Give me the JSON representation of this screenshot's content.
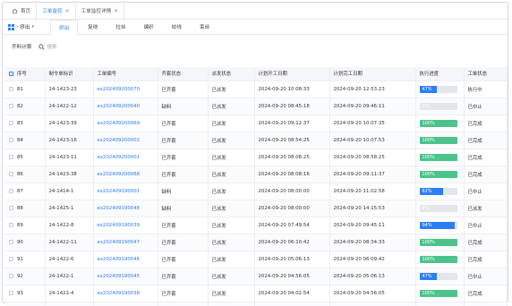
{
  "colors": {
    "accent": "#2d7ef7",
    "progress_green": "#4cc38a",
    "progress_blue": "#2d7ef7"
  },
  "tabstrip": {
    "tabs": [
      {
        "label": "首页",
        "icon": "home-icon",
        "closable": false
      },
      {
        "label": "工单监控",
        "closable": true,
        "active": true
      },
      {
        "label": "工单监控详情",
        "closable": true
      }
    ]
  },
  "subbar": {
    "crumb": "挤出",
    "tabs": [
      "挤出",
      "复绕",
      "拉丝",
      "编织",
      "绞线",
      "束丝"
    ],
    "active_tab": 0
  },
  "actions": {
    "button": "齐料计算",
    "search_placeholder": "搜索"
  },
  "table": {
    "headers": [
      "序号",
      "制令单标识",
      "工单编号",
      "齐套状态",
      "派发状态",
      "计划开工日期",
      "计划完工日期",
      "执行进度",
      "工单状态"
    ],
    "rows": [
      {
        "seq": "81",
        "order_id": "24-1423-23",
        "wo": "ex202409200070",
        "kit": "已齐套",
        "dispatch": "已派发",
        "start": "2024-09-20 10:08:33",
        "end": "2024-09-20 12:53:23",
        "progress": 47,
        "color": "blue",
        "status": "执行中"
      },
      {
        "seq": "82",
        "order_id": "24-1422-12",
        "wo": "ex202409200040",
        "kit": "缺料",
        "dispatch": "已派发",
        "start": "2024-09-20 08:45:18",
        "end": "2024-09-20 09:46:11",
        "progress": 0,
        "color": "blue",
        "status": "已中止"
      },
      {
        "seq": "83",
        "order_id": "24-1423-39",
        "wo": "ex202409200069",
        "kit": "已齐套",
        "dispatch": "已派发",
        "start": "2024-09-20 09:12:37",
        "end": "2024-09-20 10:07:35",
        "progress": 100,
        "color": "green",
        "status": "已完成"
      },
      {
        "seq": "84",
        "order_id": "24-1423-16",
        "wo": "ex202409200002",
        "kit": "已齐套",
        "dispatch": "已派发",
        "start": "2024-09-20 08:54:25",
        "end": "2024-09-20 10:07:53",
        "progress": 100,
        "color": "green",
        "status": "已完成"
      },
      {
        "seq": "85",
        "order_id": "24-1423-11",
        "wo": "ex202409200001",
        "kit": "已齐套",
        "dispatch": "已派发",
        "start": "2024-09-20 08:08:25",
        "end": "2024-09-20 08:58:25",
        "progress": 100,
        "color": "green",
        "status": "已完成"
      },
      {
        "seq": "86",
        "order_id": "24-1423-38",
        "wo": "ex202409200068",
        "kit": "已齐套",
        "dispatch": "已派发",
        "start": "2024-09-20 08:08:16",
        "end": "2024-09-20 09:11:37",
        "progress": 100,
        "color": "green",
        "status": "已完成"
      },
      {
        "seq": "87",
        "order_id": "24-1414-1",
        "wo": "ex202409190001",
        "kit": "缺料",
        "dispatch": "已派发",
        "start": "2024-09-20 08:00:00",
        "end": "2024-09-20 11:02:58",
        "progress": 62,
        "color": "blue",
        "status": "已中止"
      },
      {
        "seq": "88",
        "order_id": "24-1425-1",
        "wo": "ex202409190048",
        "kit": "缺料",
        "dispatch": "已派发",
        "start": "2024-09-20 08:00:00",
        "end": "2024-09-20 14:15:53",
        "progress": 0,
        "color": "blue",
        "status": "已派发"
      },
      {
        "seq": "89",
        "order_id": "24-1422-8",
        "wo": "ex202409190039",
        "kit": "已齐套",
        "dispatch": "已派发",
        "start": "2024-09-20 07:49:54",
        "end": "2024-09-20 09:45:11",
        "progress": 94,
        "color": "blue",
        "status": "已中止"
      },
      {
        "seq": "90",
        "order_id": "24-1422-11",
        "wo": "ex202409190047",
        "kit": "已齐套",
        "dispatch": "已派发",
        "start": "2024-09-20 06:10:42",
        "end": "2024-09-20 08:34:33",
        "progress": 100,
        "color": "green",
        "status": "已完成"
      },
      {
        "seq": "91",
        "order_id": "24-1422-6",
        "wo": "ex202409190046",
        "kit": "已齐套",
        "dispatch": "已派发",
        "start": "2024-09-20 05:06:13",
        "end": "2024-09-20 06:09:42",
        "progress": 100,
        "color": "green",
        "status": "已完成"
      },
      {
        "seq": "92",
        "order_id": "24-1422-1",
        "wo": "ex202409190045",
        "kit": "已齐套",
        "dispatch": "已派发",
        "start": "2024-09-20 04:56:05",
        "end": "2024-09-20 05:06:13",
        "progress": 47,
        "color": "blue",
        "status": "已中止"
      },
      {
        "seq": "93",
        "order_id": "24-1422-4",
        "wo": "ex202409190038",
        "kit": "已齐套",
        "dispatch": "已派发",
        "start": "2024-09-20 04:02:54",
        "end": "2024-09-20 04:56:05",
        "progress": 100,
        "color": "green",
        "status": "已完成"
      },
      {
        "seq": "94",
        "order_id": "24-1422-3",
        "wo": "ex202409190037",
        "kit": "已齐套",
        "dispatch": "已派发",
        "start": "2024-09-20 03:39:00",
        "end": "2024-09-20 04:37:26",
        "progress": 100,
        "color": "green",
        "status": "已完成"
      }
    ]
  }
}
